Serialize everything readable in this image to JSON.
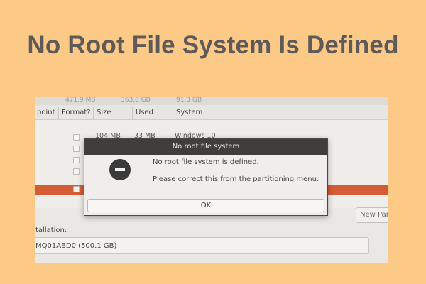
{
  "banner": {
    "title": "No Root File System Is Defined"
  },
  "installer": {
    "summary": {
      "left": "471.9 MB",
      "right": "363.8 GB",
      "far_right": "91.3 GB"
    },
    "columns": {
      "mount_point": "point",
      "format": "Format?",
      "size": "Size",
      "used": "Used",
      "system": "System"
    },
    "rows": [
      {
        "size": "104 MB",
        "used": "33 MB",
        "system": "Windows 10"
      }
    ],
    "new_partition_label": "New Par",
    "bootloader_label": "tallation:",
    "device_value": "MQ01ABD0 (500.1 GB)"
  },
  "dialog": {
    "title": "No root file system",
    "message": "No root file system is defined.",
    "hint": "Please correct this from the partitioning menu.",
    "ok_label": "OK",
    "icon": "stop-icon"
  },
  "colors": {
    "background": "#fdc987",
    "title_text": "#5e5a5a",
    "selection": "#d55d35",
    "dialog_titlebar": "#3f3e3b"
  }
}
